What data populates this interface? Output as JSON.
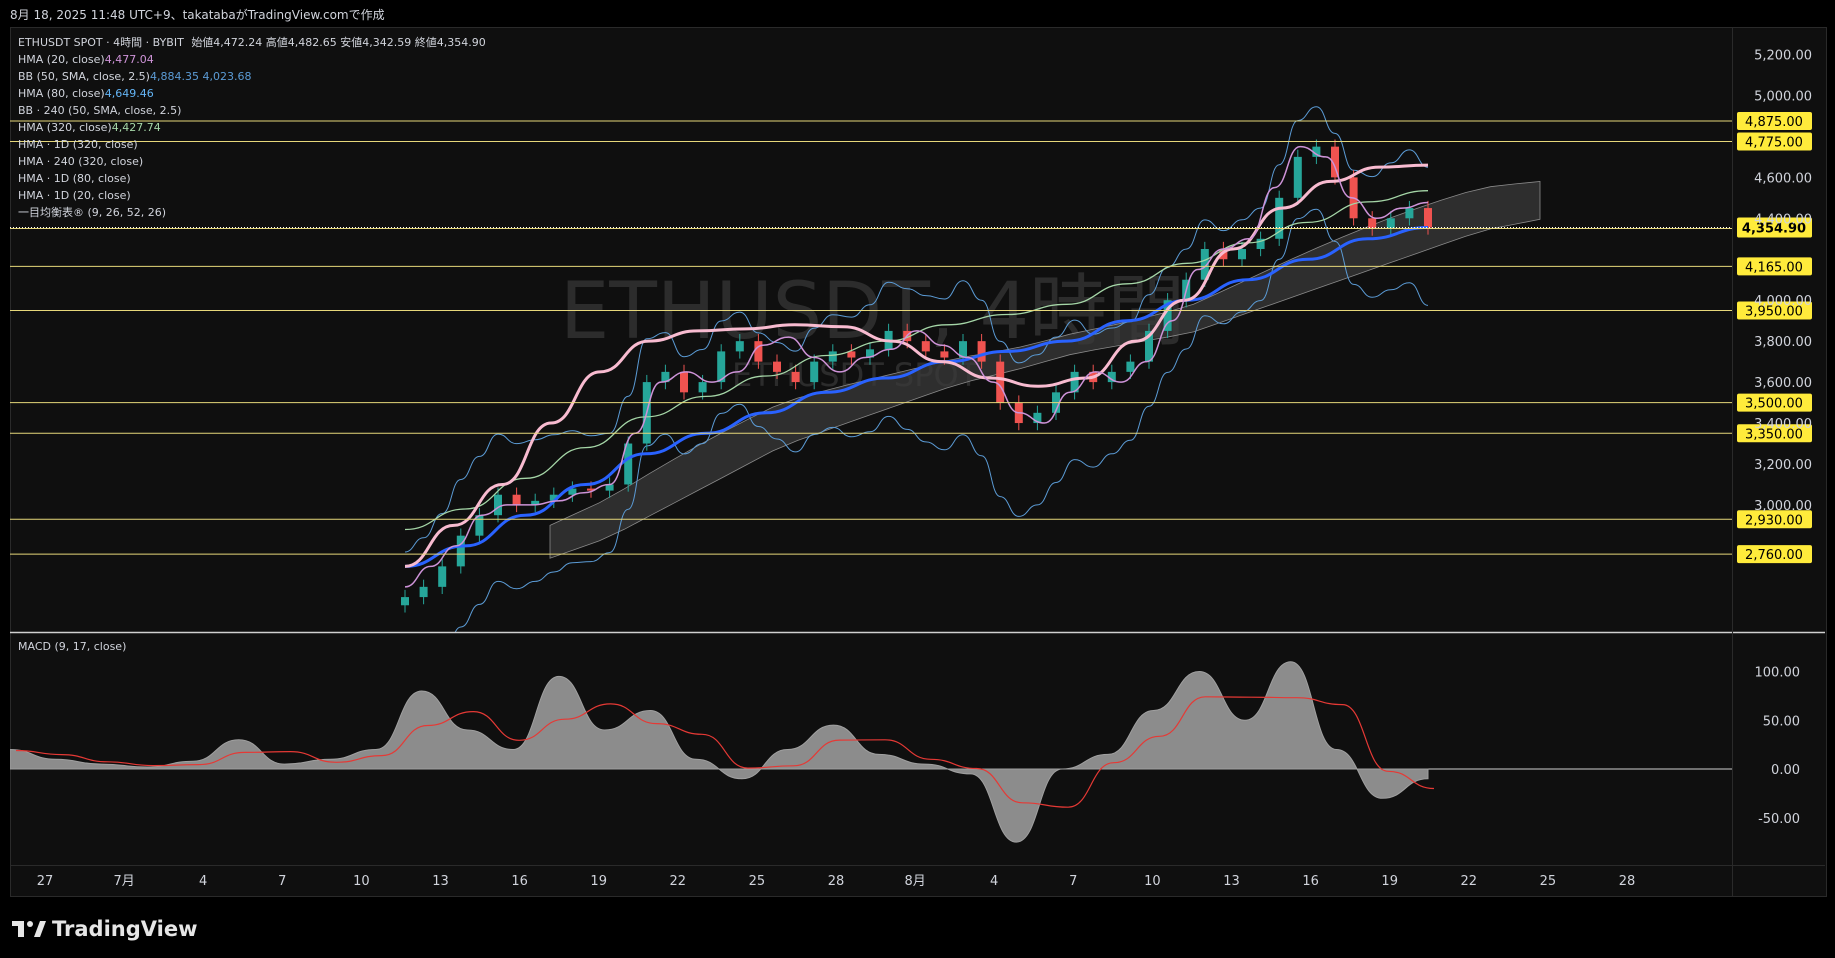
{
  "header": {
    "text": "8月 18, 2025 11:48 UTC+9、takatabaがTradingView.comで作成"
  },
  "watermark": {
    "line1": "ETHUSDT, 4時間",
    "line2": "ETHUSDT SPOT"
  },
  "legend": {
    "symbol": "ETHUSDT SPOT · 4時間 · BYBIT",
    "ohlc": "始値4,472.24  高値4,482.65  安値4,342.59  終値4,354.90",
    "rows": [
      {
        "label": "HMA (20, close)",
        "value": "4,477.04",
        "color": "#ce93d8"
      },
      {
        "label": "BB (50, SMA, close, 2.5)",
        "value": "4,884.35  4,023.68",
        "color": "#5b9bd5"
      },
      {
        "label": "HMA (80, close)",
        "value": "4,649.46",
        "color": "#64b5f6"
      },
      {
        "label": "BB · 240 (50, SMA, close, 2.5)",
        "value": "",
        "color": "#d1d4dc"
      },
      {
        "label": "HMA (320, close)",
        "value": "4,427.74",
        "color": "#a5d6a7"
      },
      {
        "label": "HMA · 1D (320, close)",
        "value": "",
        "color": "#d1d4dc"
      },
      {
        "label": "HMA · 240 (320, close)",
        "value": "",
        "color": "#d1d4dc"
      },
      {
        "label": "HMA · 1D (80, close)",
        "value": "",
        "color": "#d1d4dc"
      },
      {
        "label": "HMA · 1D (20, close)",
        "value": "",
        "color": "#d1d4dc"
      },
      {
        "label": "一目均衡表® (9, 26, 52, 26)",
        "value": "",
        "color": "#d1d4dc"
      }
    ]
  },
  "macd": {
    "label": "MACD (9, 17, close)"
  },
  "price_axis": {
    "ticks": [
      "5,200.00",
      "5,000.00",
      "4,600.00",
      "4,400.00",
      "4,000.00",
      "3,800.00",
      "3,600.00",
      "3,400.00",
      "3,200.00",
      "3,000.00"
    ],
    "tick_values": [
      5200,
      5000,
      4600,
      4400,
      4000,
      3800,
      3600,
      3400,
      3200,
      3000
    ]
  },
  "levels": [
    {
      "value": 4875,
      "label": "4,875.00"
    },
    {
      "value": 4775,
      "label": "4,775.00"
    },
    {
      "value": 4350,
      "label": "4,350.00"
    },
    {
      "value": 4165,
      "label": "4,165.00"
    },
    {
      "value": 3950,
      "label": "3,950.00"
    },
    {
      "value": 3500,
      "label": "3,500.00"
    },
    {
      "value": 3350,
      "label": "3,350.00"
    },
    {
      "value": 2930,
      "label": "2,930.00"
    },
    {
      "value": 2760,
      "label": "2,760.00"
    }
  ],
  "current_price": {
    "value": 4354.9,
    "label": "4,354.90"
  },
  "macd_axis": {
    "ticks": [
      "100.00",
      "50.00",
      "0.00",
      "-50.00"
    ],
    "tick_values": [
      100,
      50,
      0,
      -50
    ]
  },
  "time_axis": {
    "labels": [
      "27",
      "7月",
      "4",
      "7",
      "10",
      "13",
      "16",
      "19",
      "22",
      "25",
      "28",
      "8月",
      "4",
      "7",
      "10",
      "13",
      "16",
      "19",
      "22",
      "25",
      "28"
    ]
  },
  "footer": {
    "brand": "TradingView"
  },
  "colors": {
    "bg": "#0f0f0f",
    "up": "#26a69a",
    "down": "#ef5350",
    "level": "#e6d77a",
    "label_bg": "#ffeb3b",
    "hma20": "#ce93d8",
    "hma80": "#f8bbd0",
    "hma320": "#2962ff",
    "hma_green": "#a5d6a7",
    "bb": "#5b9bd5",
    "macd_hist": "#8c8c8c",
    "macd_signal": "#e53935"
  },
  "chart_data": {
    "type": "candlestick",
    "title": "ETHUSDT SPOT · 4時間 · BYBIT",
    "ylim": [
      2760,
      5300
    ],
    "x": [
      "27",
      "7月",
      "4",
      "7",
      "10",
      "13",
      "16",
      "19",
      "22",
      "25",
      "28",
      "8月",
      "4",
      "7",
      "10",
      "13",
      "16",
      "19",
      "22",
      "25",
      "28"
    ],
    "series": [
      {
        "name": "ETHUSDT close",
        "values": [
          2550,
          2600,
          2700,
          2850,
          2950,
          3050,
          3000,
          3020,
          3050,
          3080,
          3070,
          3100,
          3300,
          3600,
          3650,
          3550,
          3600,
          3750,
          3800,
          3700,
          3650,
          3600,
          3700,
          3750,
          3720,
          3760,
          3850,
          3800,
          3750,
          3720,
          3800,
          3700,
          3500,
          3400,
          3450,
          3550,
          3650,
          3600,
          3650,
          3700,
          3850,
          4000,
          4100,
          4250,
          4200,
          4250,
          4300,
          4500,
          4700,
          4750,
          4600,
          4400,
          4350,
          4400,
          4450,
          4355
        ]
      },
      {
        "name": "HMA (20, close)",
        "values": [
          2600,
          2700,
          2800,
          2950,
          3000,
          3000,
          3020,
          3060,
          3100,
          3350,
          3600,
          3650,
          3600,
          3650,
          3780,
          3820,
          3720,
          3650,
          3720,
          3760,
          3850,
          3780,
          3720,
          3600,
          3450,
          3400,
          3550,
          3650,
          3600,
          3700,
          3900,
          4150,
          4250,
          4300,
          4550,
          4750,
          4700,
          4500,
          4400,
          4450,
          4477
        ]
      },
      {
        "name": "HMA (80, close)",
        "values": [
          2700,
          2900,
          3100,
          3400,
          3650,
          3800,
          3850,
          3860,
          3880,
          3870,
          3800,
          3700,
          3620,
          3580,
          3620,
          3800,
          4000,
          4250,
          4450,
          4580,
          4650,
          4660
        ]
      },
      {
        "name": "HMA (320, close)",
        "values": [
          2700,
          2800,
          2950,
          3100,
          3250,
          3350,
          3450,
          3550,
          3620,
          3700,
          3750,
          3800,
          3900,
          4000,
          4100,
          4200,
          4300,
          4355
        ]
      },
      {
        "name": "MACD",
        "values": [
          20,
          10,
          5,
          2,
          8,
          30,
          5,
          10,
          20,
          80,
          40,
          20,
          95,
          40,
          60,
          10,
          -10,
          20,
          45,
          15,
          5,
          -5,
          -75,
          0,
          15,
          60,
          100,
          50,
          110,
          20,
          -30,
          -10
        ]
      }
    ]
  }
}
